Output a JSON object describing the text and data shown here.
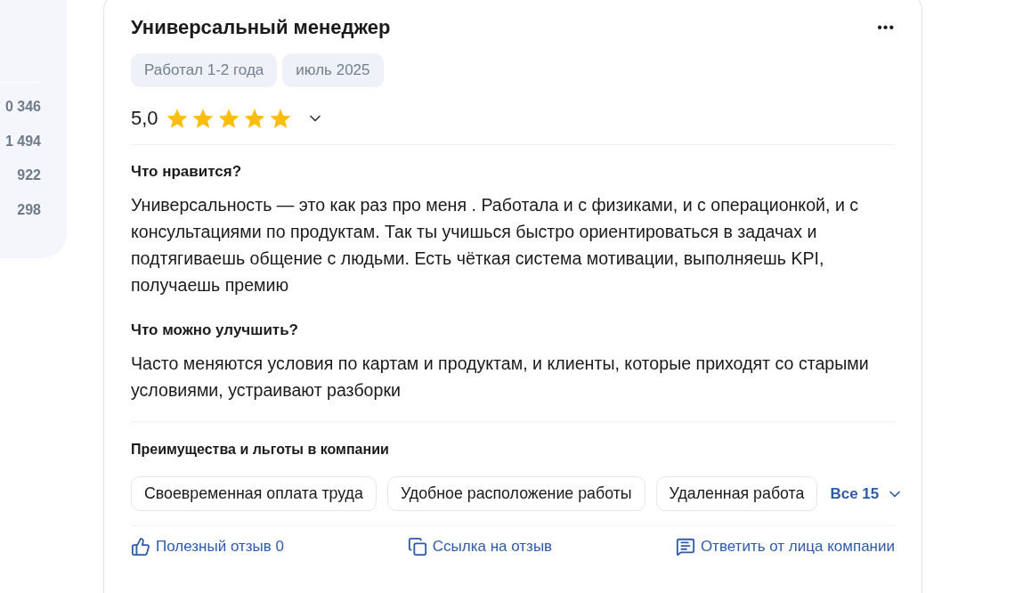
{
  "sidebar": {
    "counts": [
      "0 346",
      "1 494",
      "922",
      "298"
    ]
  },
  "review": {
    "title": "Универсальный менеджер",
    "menu_icon": "•••",
    "tags": [
      "Работал 1-2 года",
      "июль 2025"
    ],
    "rating": {
      "value": "5,0",
      "stars": 5,
      "expanded": false
    },
    "sections": [
      {
        "heading": "Что нравится?",
        "text": "Универсальность — это как раз про меня . Работала и с физиками, и с операционкой, и с консультациями по продуктам. Так ты учишься быстро ориентироваться в задачах и подтягиваешь общение с людьми. Есть чёткая система мотивации, выполняешь KPI, получаешь премию"
      },
      {
        "heading": "Что можно улучшить?",
        "text": "Часто меняются условия по картам и продуктам, и клиенты, которые приходят со старыми условиями, устраивают разборки"
      }
    ],
    "benefits": {
      "heading": "Преимущества и льготы в компании",
      "items": [
        "Своевременная оплата труда",
        "Удобное расположение работы",
        "Удаленная работа"
      ],
      "more": "Все 15",
      "expanded": false
    },
    "actions": [
      {
        "kind": "like",
        "label": "Полезный отзыв 0"
      },
      {
        "kind": "link",
        "label": "Ссылка на отзыв"
      },
      {
        "kind": "reply",
        "label": "Ответить от лица компании"
      }
    ]
  }
}
